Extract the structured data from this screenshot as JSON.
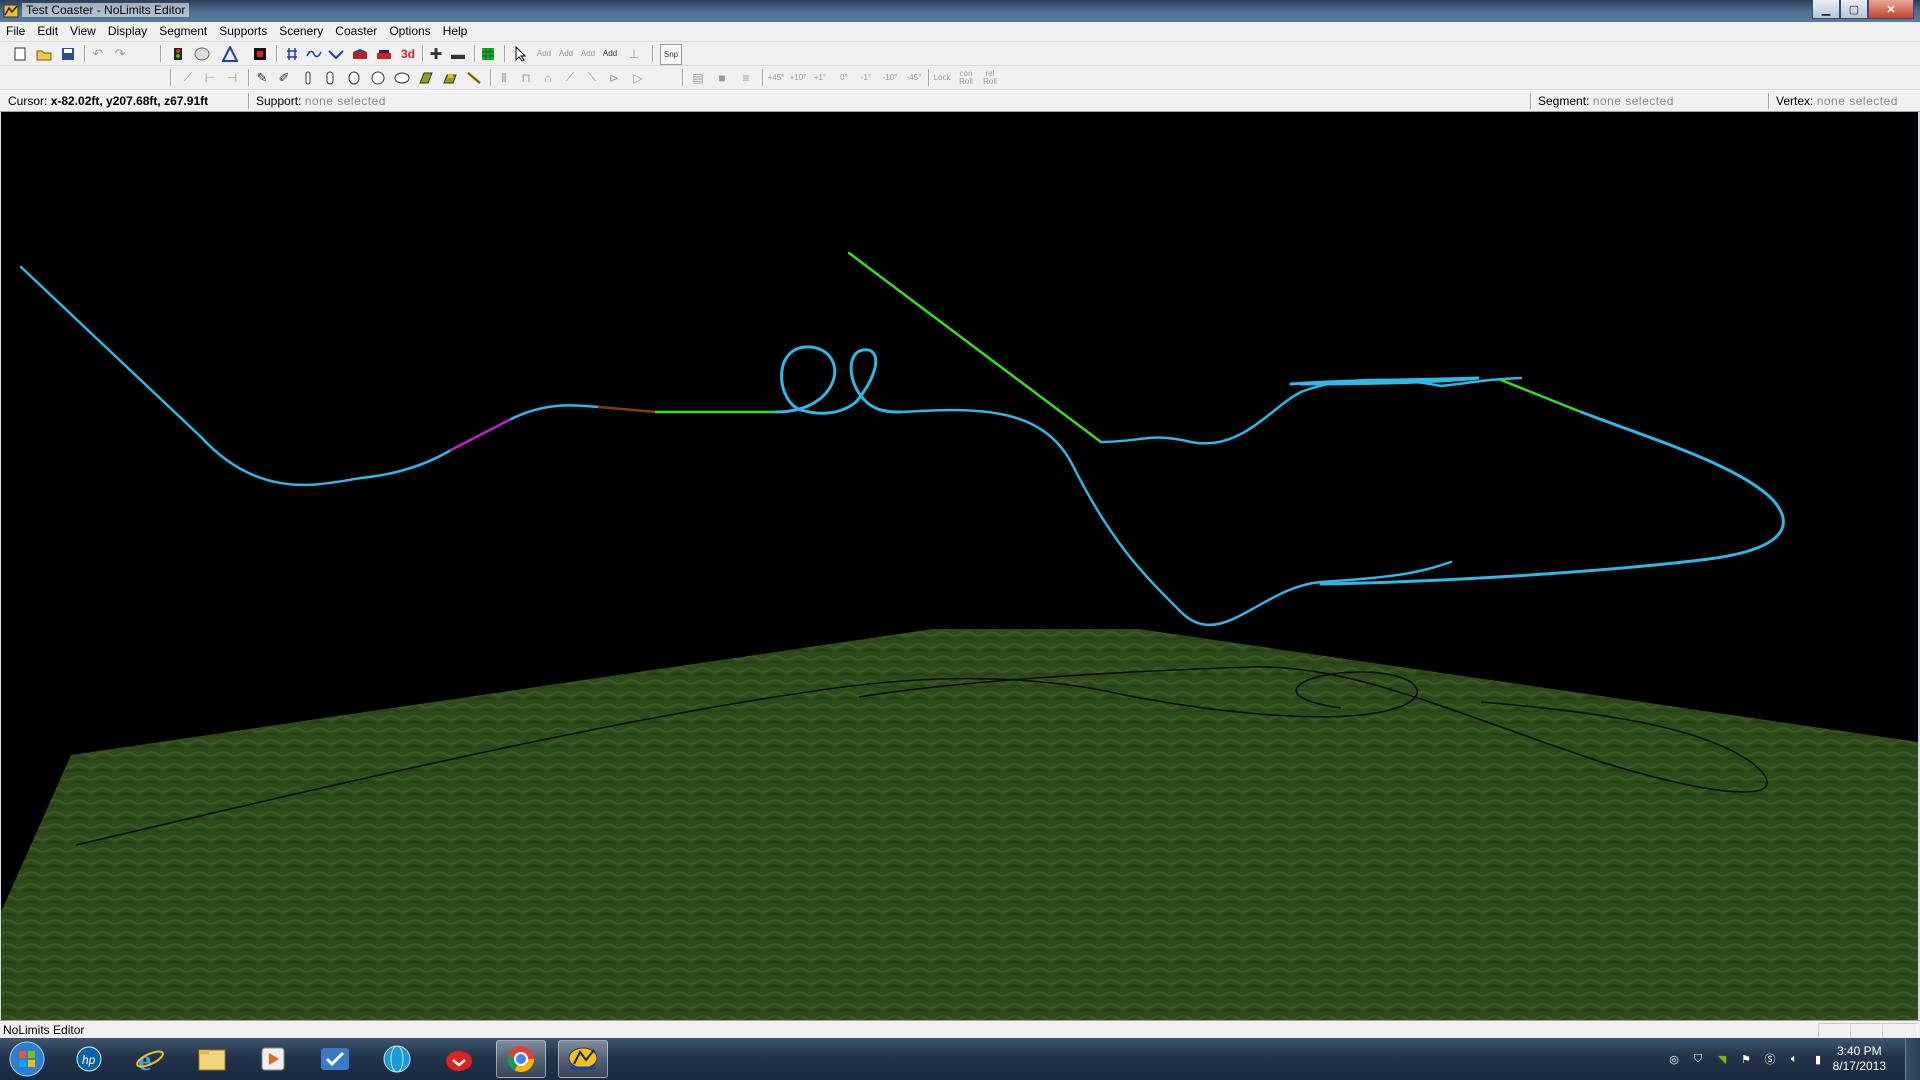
{
  "window": {
    "title": "Test Coaster - NoLimits Editor",
    "controls": [
      "minimize-icon",
      "maximize-icon",
      "close-icon"
    ]
  },
  "menu": [
    "File",
    "Edit",
    "View",
    "Display",
    "Segment",
    "Supports",
    "Scenery",
    "Coaster",
    "Options",
    "Help"
  ],
  "toolbar": {
    "mode_3d_label": "3d",
    "snap_label": "Snp",
    "add_labels": [
      "Add",
      "Add",
      "Add",
      "Add"
    ],
    "angle_labels": [
      "+45°",
      "+10°",
      "+1°",
      "0°",
      "-1°",
      "-10°",
      "-45°"
    ],
    "lock_labels": [
      "Lock",
      "con Roll",
      "rel Roll"
    ]
  },
  "status": {
    "cursor_label": "Cursor:",
    "cursor_value": "x-82.02ft, y207.68ft, z67.91ft",
    "support_label": "Support:",
    "support_value": "none selected",
    "segment_label": "Segment:",
    "segment_value": "none selected",
    "vertex_label": "Vertex:",
    "vertex_value": "none selected"
  },
  "viewport": {
    "background": "#000000",
    "ground_color": "#2f4a1a",
    "track_color": "#2fb8e6",
    "accent_colors": [
      "#36e01c",
      "#c21fc8",
      "#7a3f10"
    ],
    "shadow_color": "#101010"
  },
  "app_status": {
    "text": "NoLimits Editor"
  },
  "taskbar": {
    "apps": [
      "start-orb-icon",
      "hp-icon",
      "internet-explorer-icon",
      "file-explorer-icon",
      "media-player-icon",
      "checkmark-app-icon",
      "globe-app-icon",
      "red-app-icon",
      "chrome-icon",
      "nolimits-icon"
    ],
    "time": "3:40 PM",
    "date": "8/17/2013"
  }
}
